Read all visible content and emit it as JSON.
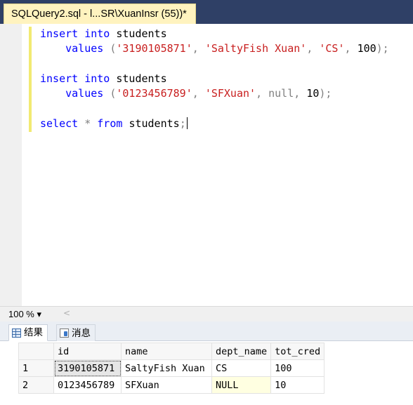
{
  "tab": {
    "title": "SQLQuery2.sql - l...SR\\XuanInsr (55))*"
  },
  "editor": {
    "lines": [
      {
        "kw1": "insert",
        "kw2": "into",
        "rest": "students"
      },
      {
        "kw": "values",
        "p1": "(",
        "s1": "'3190105871'",
        "c1": ",",
        "s2": "'SaltyFish Xuan'",
        "c2": ",",
        "s3": "'CS'",
        "c3": ",",
        "n": "100",
        "end": ");"
      },
      {
        "kw1": "insert",
        "kw2": "into",
        "rest": "students"
      },
      {
        "kw": "values",
        "p1": "(",
        "s1": "'0123456789'",
        "c1": ",",
        "s2": "'SFXuan'",
        "c2": ",",
        "nl": "null",
        "c3": ",",
        "n": "10",
        "end": ");"
      },
      {
        "kw1": "select",
        "star": "*",
        "kw2": "from",
        "rest": "students",
        "semi": ";"
      }
    ]
  },
  "zoom": {
    "value": "100 %",
    "dropdown_arrow": "▾",
    "scroll_left": "<"
  },
  "results_tabs": {
    "results": "结果",
    "messages": "消息"
  },
  "grid": {
    "columns": [
      "id",
      "name",
      "dept_name",
      "tot_cred"
    ],
    "rows": [
      {
        "rn": "1",
        "id": "3190105871",
        "name": "SaltyFish Xuan",
        "dept_name": "CS",
        "tot_cred": "100"
      },
      {
        "rn": "2",
        "id": "0123456789",
        "name": "SFXuan",
        "dept_name": "NULL",
        "tot_cred": "10"
      }
    ]
  }
}
